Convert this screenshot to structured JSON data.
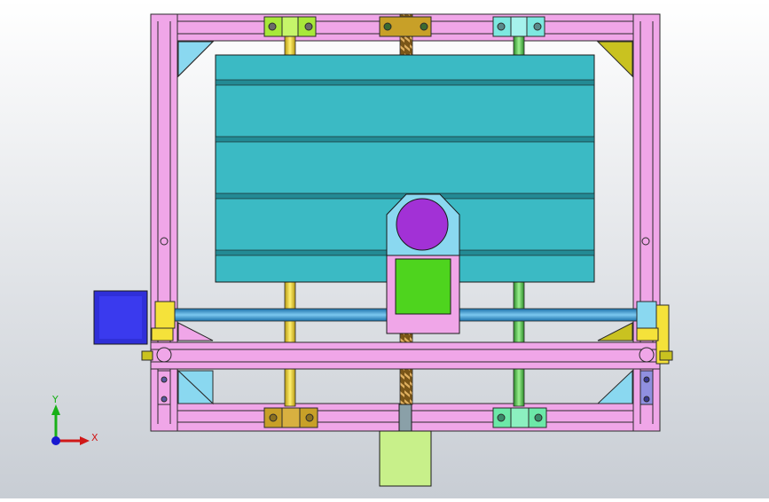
{
  "viewport": {
    "background_top": "#ffffff",
    "background_bottom": "#c8cdd4"
  },
  "colors": {
    "frame_pink": "#f0a6e8",
    "frame_edge": "#2b2b2b",
    "bed_cyan": "#3bbac4",
    "bed_dark": "#238a94",
    "rod_yellow": "#f4d21c",
    "rod_green": "#4fc34a",
    "leadscrew_bronze": "#b88a3c",
    "leadscrew_blue": "#1f8fd0",
    "motor_blue": "#2f2fd8",
    "motor_lightgreen": "#c8f08a",
    "spindle_purple": "#a231d6",
    "carriage_green": "#4ed41e",
    "carriage_lightblue": "#8ad8f0",
    "bracket_olive": "#c9c220",
    "bracket_lightblue": "#8ad8f0",
    "block_lime": "#a8e83a",
    "block_olive": "#c8a028",
    "block_cyan": "#7de8e0",
    "block_mint": "#6ce8a8",
    "endcap_yellow": "#f5e23a"
  },
  "triad": {
    "x_label": "X",
    "y_label": "Y",
    "x_color": "#d01818",
    "y_color": "#18b018",
    "z_color": "#1818d0"
  },
  "icons": {
    "triad": "coordinate-axes-icon"
  }
}
